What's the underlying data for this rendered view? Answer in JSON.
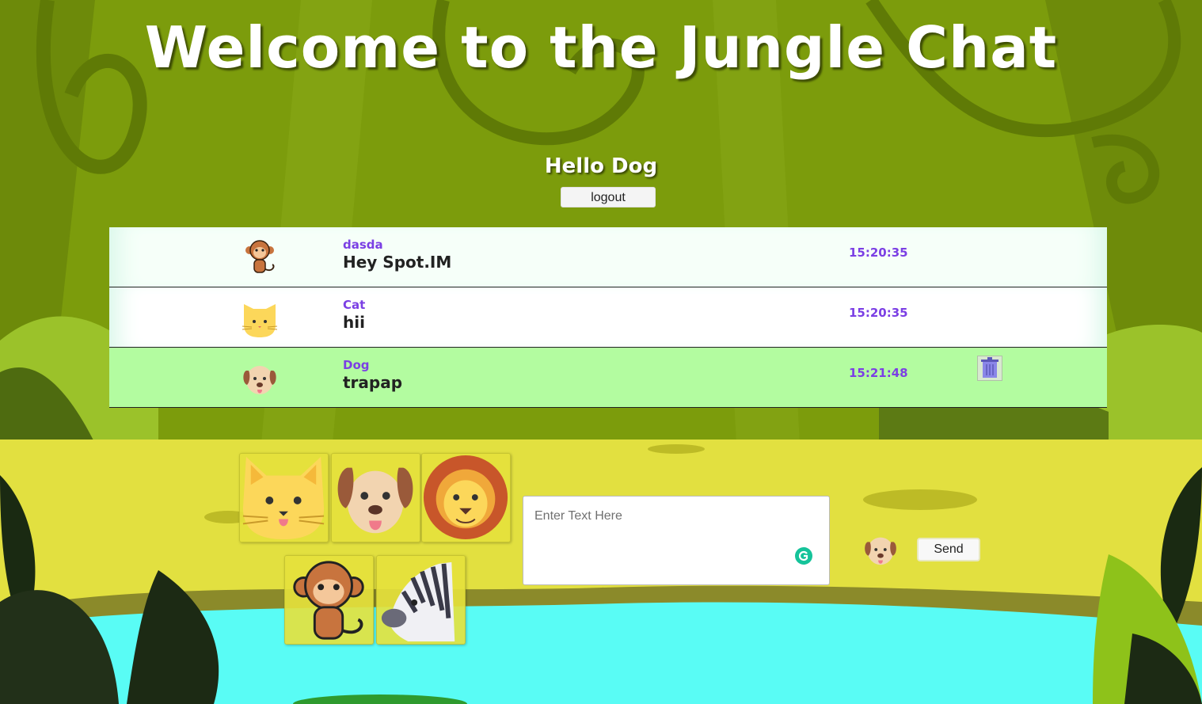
{
  "page": {
    "title": "Welcome to the Jungle Chat",
    "greeting": "Hello Dog",
    "logout_label": "logout"
  },
  "messages": [
    {
      "author": "dasda",
      "text": "Hey Spot.IM",
      "time": "15:20:35",
      "avatar": "monkey-icon",
      "own": false
    },
    {
      "author": "Cat",
      "text": "hii",
      "time": "15:20:35",
      "avatar": "cat-icon",
      "own": false
    },
    {
      "author": "Dog",
      "text": "trapap",
      "time": "15:21:48",
      "avatar": "dog-icon",
      "own": true
    }
  ],
  "avatar_picker": [
    "cat-icon",
    "dog-icon",
    "lion-icon",
    "monkey-icon",
    "zebra-icon"
  ],
  "composer": {
    "placeholder": "Enter Text Here",
    "value": "",
    "send_label": "Send",
    "current_avatar": "dog-icon"
  },
  "colors": {
    "jungle_green": "#7a9b0e",
    "ground_yellow": "#e2e040",
    "water": "#59fcf5",
    "own_message": "#b3fca0",
    "accent_purple": "#7b3fe4"
  }
}
